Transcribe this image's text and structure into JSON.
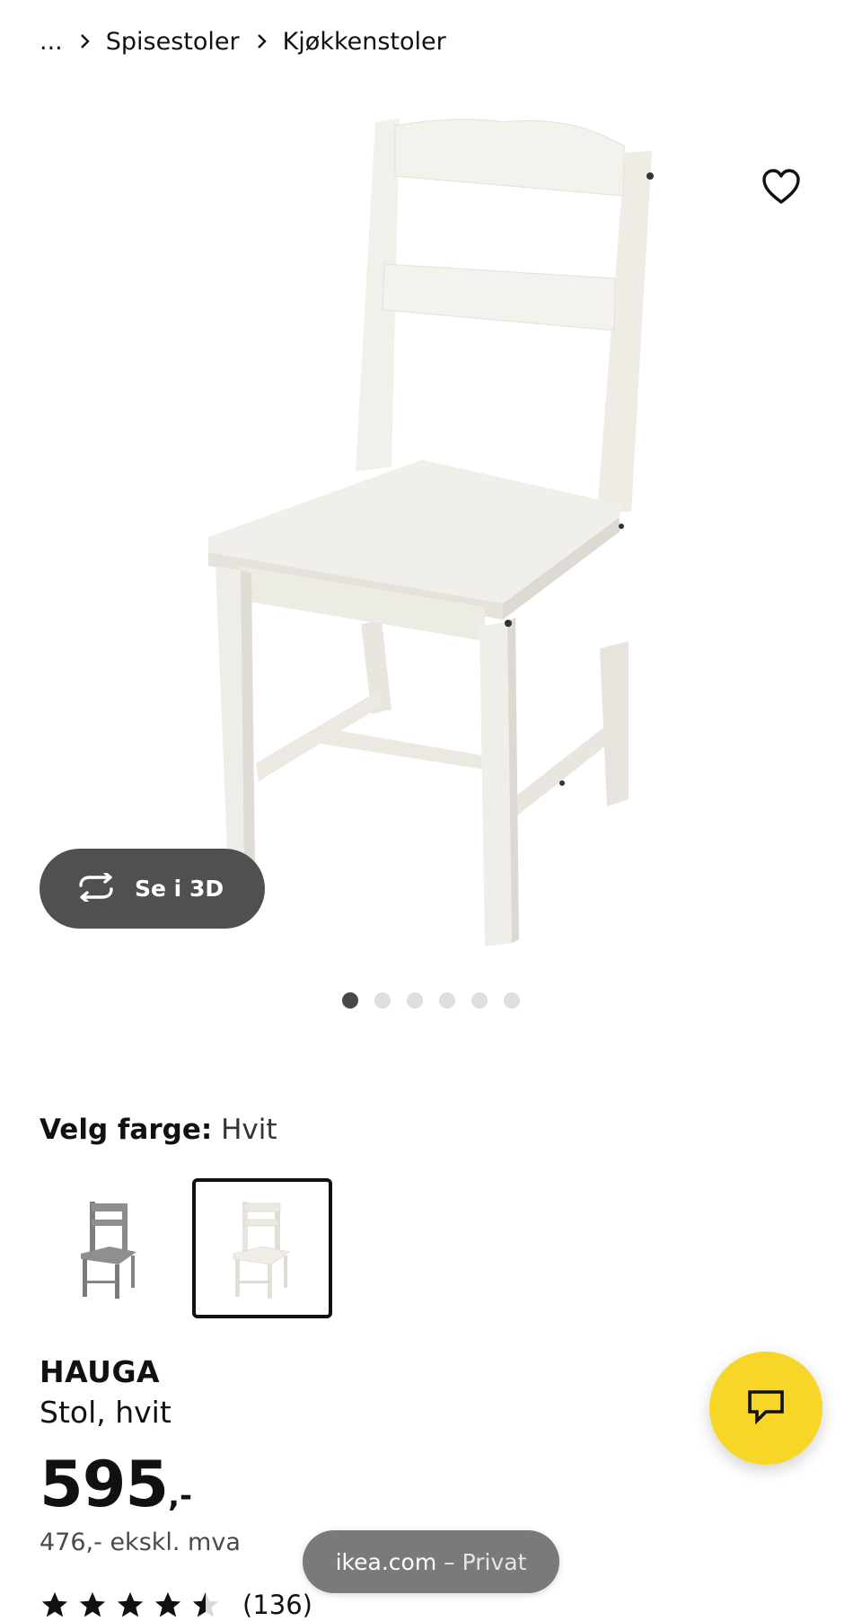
{
  "breadcrumb": {
    "ellipsis": "...",
    "items": [
      "Spisestoler",
      "Kjøkkenstoler"
    ]
  },
  "hero": {
    "favorite_icon": "heart-outline-icon",
    "see3d": {
      "icon": "rotate-3d-icon",
      "label": "Se i 3D"
    },
    "carousel": {
      "total": 6,
      "active_index": 0
    }
  },
  "color": {
    "label": "Velg farge:",
    "value": "Hvit",
    "options": [
      {
        "name": "grey-chair",
        "color": "#8a8a8a",
        "selected": false
      },
      {
        "name": "white-chair",
        "color": "#f1efe8",
        "selected": true
      }
    ]
  },
  "product": {
    "name": "HAUGA",
    "description": "Stol, hvit",
    "price": "595",
    "price_suffix": ",-",
    "price_ex_vat": "476,- ekskl. mva"
  },
  "rating": {
    "value": 4.5,
    "max": 5,
    "count": "(136)"
  },
  "chat": {
    "icon": "chat-bubble-icon",
    "color": "#f7d628"
  },
  "browser": {
    "domain": "ikea.com",
    "mode": "– Privat"
  }
}
